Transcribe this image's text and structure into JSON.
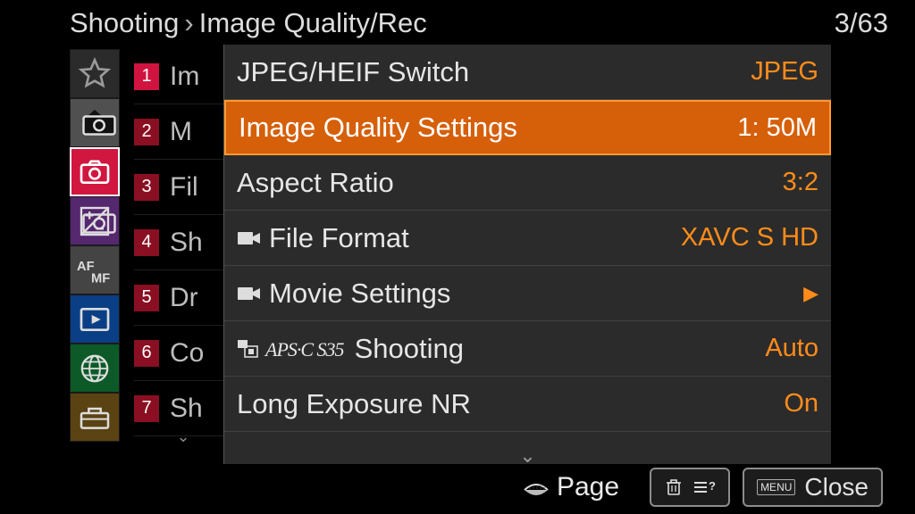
{
  "header": {
    "crumb_root": "Shooting",
    "crumb_leaf": "Image Quality/Rec",
    "page_counter": "3/63"
  },
  "sub": {
    "items": [
      {
        "num": "1",
        "txt": "Im",
        "active": true
      },
      {
        "num": "2",
        "txt": "M"
      },
      {
        "num": "3",
        "txt": "Fil"
      },
      {
        "num": "4",
        "txt": "Sh"
      },
      {
        "num": "5",
        "txt": "Dr"
      },
      {
        "num": "6",
        "txt": "Co"
      },
      {
        "num": "7",
        "txt": "Sh"
      }
    ]
  },
  "rows": [
    {
      "label": "JPEG/HEIF Switch",
      "value": "JPEG"
    },
    {
      "label": "Image Quality Settings",
      "value": "1: 50M",
      "selected": true
    },
    {
      "label": "Aspect Ratio",
      "value": "3:2"
    },
    {
      "label": "File Format",
      "value": "XAVC S HD",
      "movie": true
    },
    {
      "label": "Movie Settings",
      "value": "▶",
      "movie": true,
      "arrow": true
    },
    {
      "label": "Shooting",
      "value": "Auto",
      "apsc": true,
      "apsc_text": "APS·C S35"
    },
    {
      "label": "Long Exposure NR",
      "value": "On"
    }
  ],
  "footer": {
    "page_label": "Page",
    "close_label": "Close",
    "menu_key": "MENU"
  }
}
